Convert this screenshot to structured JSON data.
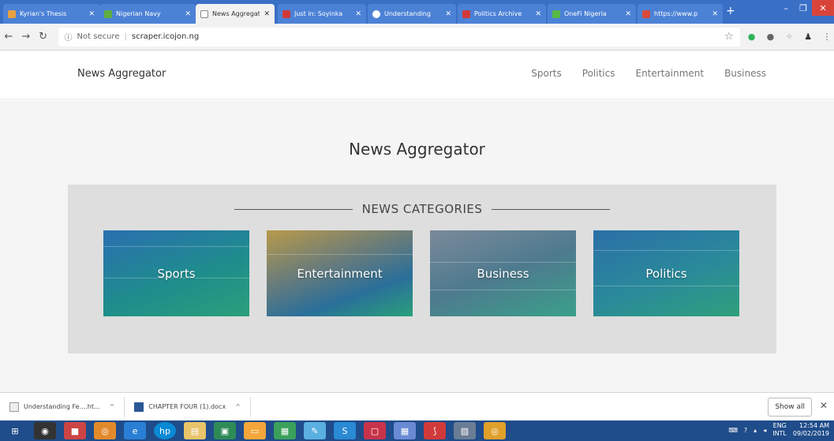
{
  "browser": {
    "tabs": [
      {
        "label": "Kyrian's Thesis",
        "icon": "document-icon",
        "color": "#e8a040"
      },
      {
        "label": "Nigerian Navy",
        "icon": "navy-icon",
        "color": "#5fae3f"
      },
      {
        "label": "News Aggregat",
        "icon": "page-icon",
        "color": "#ffffff"
      },
      {
        "label": "Just in: Soyinka",
        "icon": "v-icon",
        "color": "#d13a3a"
      },
      {
        "label": "Understanding",
        "icon": "circle-icon",
        "color": "#ffffff"
      },
      {
        "label": "Politics Archive",
        "icon": "v-icon",
        "color": "#d13a3a"
      },
      {
        "label": "OneFi Nigeria",
        "icon": "leaf-icon",
        "color": "#57b845"
      },
      {
        "label": "https://www.p",
        "icon": "mail-icon",
        "color": "#d94a3a"
      }
    ],
    "new_tab": "+",
    "address": {
      "security": "Not secure",
      "url": "scraper.icojon.ng"
    }
  },
  "site": {
    "brand": "News Aggregator",
    "nav": [
      "Sports",
      "Politics",
      "Entertainment",
      "Business"
    ],
    "page_title": "News Aggregator",
    "categories_heading": "NEWS CATEGORIES",
    "cards": [
      "Sports",
      "Entertainment",
      "Business",
      "Politics"
    ]
  },
  "downloads": {
    "items": [
      "Understanding Fe....ht...",
      "CHAPTER FOUR (1).docx"
    ],
    "show_all": "Show all"
  },
  "taskbar": {
    "lang": "ENG",
    "layout": "INTL",
    "time": "12:54 AM",
    "date": "09/02/2019"
  }
}
